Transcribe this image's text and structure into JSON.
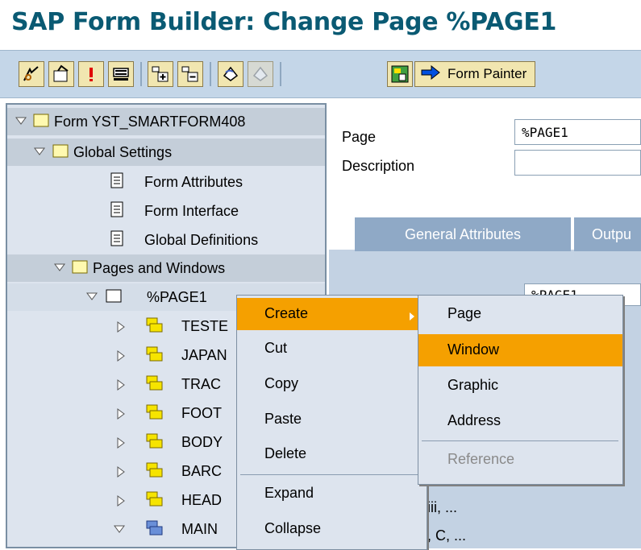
{
  "title": "SAP Form Builder: Change Page %PAGE1",
  "toolbar": {
    "form_painter_label": "Form Painter",
    "icons": [
      "other-object-icon",
      "display-change-icon",
      "check-icon",
      "test-icon",
      "expand-icon",
      "collapse-icon",
      "undo-icon",
      "redo-icon",
      "graphic-icon",
      "form-painter-arrow-icon"
    ]
  },
  "tree": {
    "root": "Form YST_SMARTFORM408",
    "global_settings": "Global Settings",
    "form_attributes": "Form Attributes",
    "form_interface": "Form Interface",
    "global_definitions": "Global Definitions",
    "pages_and_windows": "Pages and Windows",
    "page1": "%PAGE1",
    "windows": [
      "TESTE",
      "JAPAN",
      "TRAC",
      "FOOT",
      "BODY",
      "BARC",
      "HEAD",
      "MAIN"
    ]
  },
  "form": {
    "page_label": "Page",
    "page_value": "%PAGE1",
    "description_label": "Description",
    "description_value": "",
    "tabs": [
      "General Attributes",
      "Outpu"
    ],
    "partial_field_value": "%PAGE1",
    "snippet_1": "iii, ...",
    "snippet_2": ", C, ..."
  },
  "context_menu": {
    "items": [
      "Create",
      "Cut",
      "Copy",
      "Paste",
      "Delete",
      "Expand",
      "Collapse"
    ],
    "active": "Create"
  },
  "submenu": {
    "items": [
      "Page",
      "Window",
      "Graphic",
      "Address",
      "Reference"
    ],
    "active": "Window",
    "disabled": [
      "Reference"
    ]
  },
  "colors": {
    "title": "#0a5a73",
    "toolbar_bg": "#c4d6e8",
    "menu_highlight": "#f5a000",
    "tab_bg": "#8fa9c6",
    "folder_yellow": "#f6e400"
  }
}
